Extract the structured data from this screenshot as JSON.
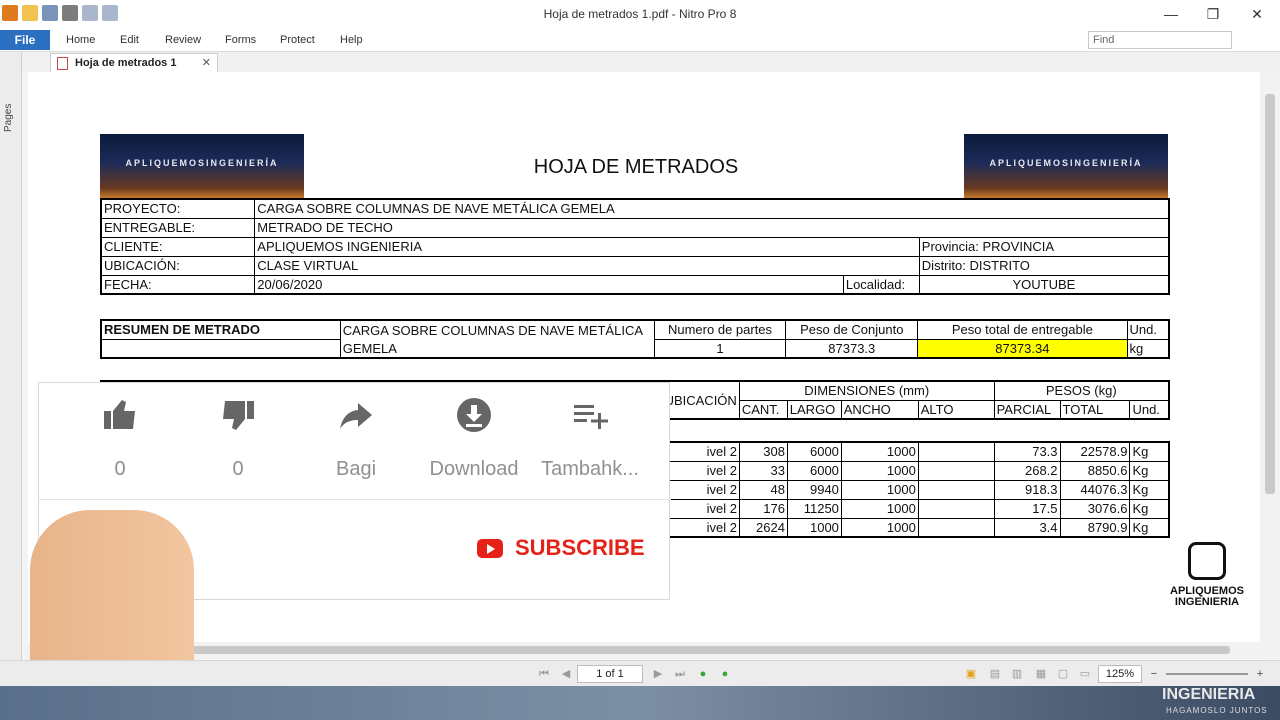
{
  "window": {
    "title": "Hoja de metrados 1.pdf - Nitro Pro 8",
    "minimize": "—",
    "maximize": "❐",
    "close": "✕"
  },
  "menu": {
    "file": "File",
    "items": [
      "Home",
      "Edit",
      "Review",
      "Forms",
      "Protect",
      "Help"
    ],
    "find_placeholder": "Find"
  },
  "tab": {
    "label": "Hoja de metrados 1",
    "close": "✕"
  },
  "sidepanel": {
    "label": "Pages"
  },
  "doc": {
    "banner_text": "APLIQUEMOSINGENIERÍA",
    "title": "HOJA DE METRADOS",
    "info": {
      "proyecto_label": "PROYECTO:",
      "proyecto": "CARGA SOBRE COLUMNAS DE NAVE METÁLICA GEMELA",
      "entregable_label": "ENTREGABLE:",
      "entregable": "METRADO DE TECHO",
      "cliente_label": "CLIENTE:",
      "cliente": "APLIQUEMOS INGENIERIA",
      "provincia": "Provincia: PROVINCIA",
      "ubicacion_label": "UBICACIÓN:",
      "ubicacion": "CLASE VIRTUAL",
      "distrito": "Distrito: DISTRITO",
      "fecha_label": "FECHA:",
      "fecha": "20/06/2020",
      "localidad_label": "Localidad:",
      "localidad": "YOUTUBE"
    },
    "summary": {
      "label": "RESUMEN DE METRADO",
      "desc1": "CARGA SOBRE COLUMNAS DE NAVE METÁLICA",
      "desc2": "GEMELA",
      "partes_label": "Numero de partes",
      "partes": "1",
      "conjunto_label": "Peso de Conjunto",
      "conjunto": "87373.3",
      "total_label": "Peso total de entregable",
      "total": "87373.34",
      "und_label": "Und.",
      "und": "kg"
    },
    "headers": {
      "ubicacion": "UBICACIÓN",
      "dimensiones": "DIMENSIONES (mm)",
      "pesos": "PESOS (kg)",
      "cant": "CANT.",
      "largo": "LARGO",
      "ancho": "ANCHO",
      "alto": "ALTO",
      "parcial": "PARCIAL",
      "total": "TOTAL",
      "und": "Und."
    },
    "rows": [
      {
        "ubic": "ivel 2",
        "cant": "308",
        "largo": "6000",
        "ancho": "1000",
        "alto": "",
        "parcial": "73.3",
        "total": "22578.9",
        "und": "Kg"
      },
      {
        "ubic": "ivel 2",
        "cant": "33",
        "largo": "6000",
        "ancho": "1000",
        "alto": "",
        "parcial": "268.2",
        "total": "8850.6",
        "und": "Kg"
      },
      {
        "ubic": "ivel 2",
        "cant": "48",
        "largo": "9940",
        "ancho": "1000",
        "alto": "",
        "parcial": "918.3",
        "total": "44076.3",
        "und": "Kg"
      },
      {
        "ubic": "ivel 2",
        "cant": "176",
        "largo": "11250",
        "ancho": "1000",
        "alto": "",
        "parcial": "17.5",
        "total": "3076.6",
        "und": "Kg"
      },
      {
        "ubic": "ivel 2",
        "cant": "2624",
        "largo": "1000",
        "ancho": "1000",
        "alto": "",
        "parcial": "3.4",
        "total": "8790.9",
        "und": "Kg"
      }
    ],
    "logo": {
      "line1": "APLIQUEMOS",
      "line2": "INGENIERIA"
    }
  },
  "overlay": {
    "like_count": "0",
    "dislike_count": "0",
    "share": "Bagi",
    "download": "Download",
    "add": "Tambahk...",
    "subscribe": "SUBSCRIBE"
  },
  "status": {
    "page": "1 of 1",
    "zoom": "125%"
  },
  "bottom": {
    "line1": "INGENIERIA",
    "line2": "HAGAMOSLO JUNTOS"
  }
}
